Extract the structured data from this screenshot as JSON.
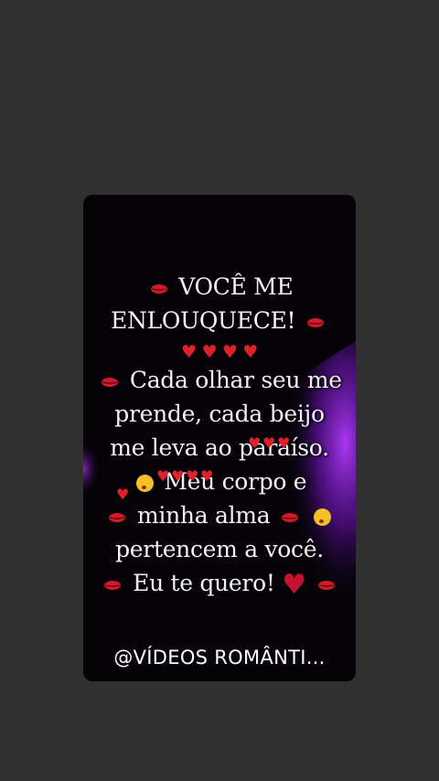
{
  "story": {
    "line1": "VOCÊ ME",
    "line2": "ENLOUQUECE!",
    "line3": "Cada olhar seu me",
    "line4": "prende, cada beijo",
    "line5": "me leva ao paraíso.",
    "line6": "Meu corpo e",
    "line7": "minha alma",
    "line8": "pertencem a você.",
    "line9": "Eu te quero!",
    "footer": "@VÍDEOS ROMÂNTI..."
  },
  "icons": {
    "heart": "♥",
    "kiss": "kiss-mark-icon",
    "face": "face-blowing-kiss-icon"
  },
  "colors": {
    "page_bg": "#303030",
    "card_bg": "#050308",
    "accent_purple": "#8b1fc9",
    "heart_red": "#e0202a"
  }
}
